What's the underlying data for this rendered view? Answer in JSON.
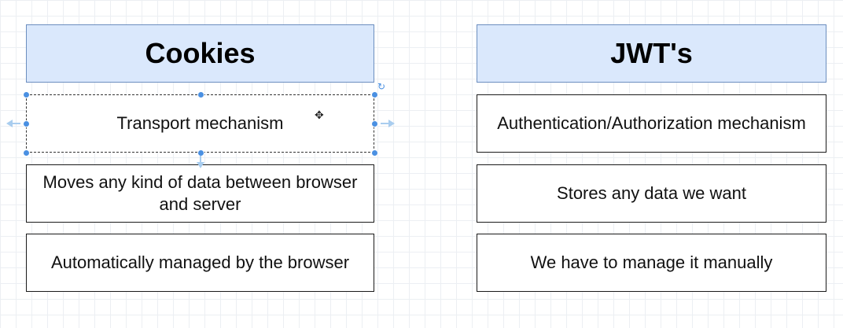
{
  "left_column": {
    "header": "Cookies",
    "items": [
      "Transport mechanism",
      "Moves any kind of data between browser and server",
      "Automatically managed by the browser"
    ]
  },
  "right_column": {
    "header": "JWT's",
    "items": [
      "Authentication/Authorization mechanism",
      "Stores any data we want",
      "We have to manage it manually"
    ]
  },
  "colors": {
    "header_fill": "#dae8fc",
    "header_border": "#6c8ebf",
    "selection_handle": "#4a90e2"
  },
  "icons": {
    "rotate": "rotate-icon",
    "move": "move-cursor-icon"
  }
}
